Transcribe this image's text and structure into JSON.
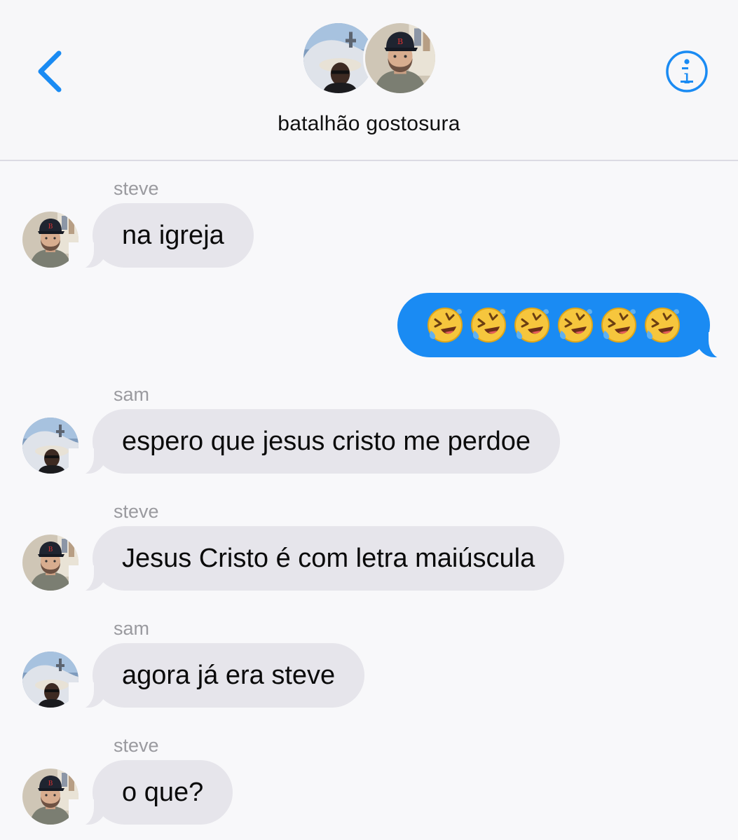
{
  "header": {
    "title": "batalhão gostosura",
    "back_icon": "chevron-left-icon",
    "info_icon": "info-icon",
    "accent": "#1a8bf3"
  },
  "participants": [
    "sam",
    "steve"
  ],
  "messages": [
    {
      "sender": "steve",
      "text": "na igreja",
      "direction": "incoming"
    },
    {
      "sender": "",
      "text": "🤣🤣🤣🤣🤣🤣",
      "direction": "outgoing",
      "emoji_count": 6,
      "emoji_icon": "rolling-on-floor-laughing-emoji"
    },
    {
      "sender": "sam",
      "text": "espero que jesus cristo me perdoe",
      "direction": "incoming"
    },
    {
      "sender": "steve",
      "text": "Jesus Cristo é com letra maiúscula",
      "direction": "incoming"
    },
    {
      "sender": "sam",
      "text": "agora já era steve",
      "direction": "incoming"
    },
    {
      "sender": "steve",
      "text": "o que?",
      "direction": "incoming"
    }
  ],
  "colors": {
    "incoming_bubble": "#e6e5eb",
    "outgoing_bubble": "#1a8bf3",
    "sender_label": "#9a9a9f"
  }
}
